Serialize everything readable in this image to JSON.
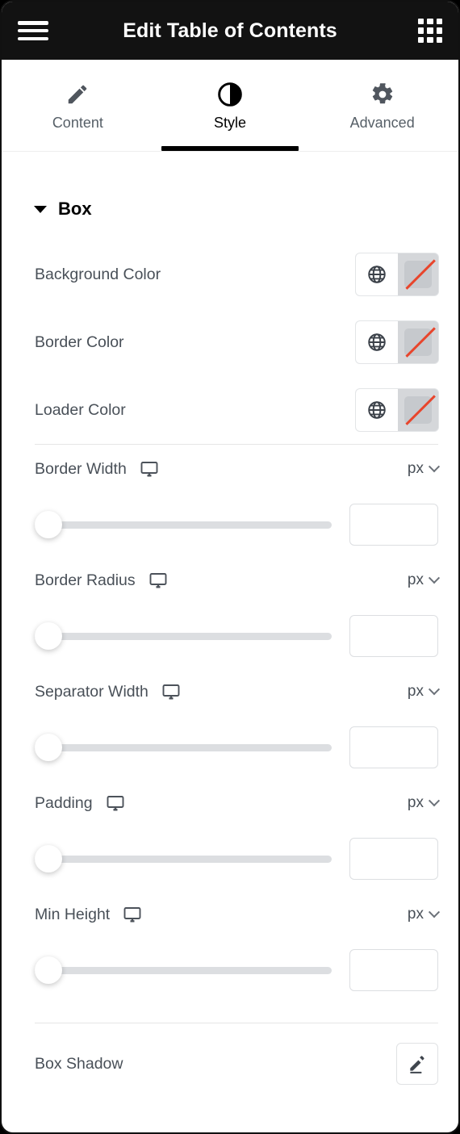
{
  "header": {
    "title": "Edit Table of Contents",
    "menu_icon": "hamburger-menu-icon",
    "apps_icon": "apps-grid-icon"
  },
  "tabs": [
    {
      "label": "Content",
      "icon": "pencil-icon",
      "active": false
    },
    {
      "label": "Style",
      "icon": "half-circle-contrast-icon",
      "active": true
    },
    {
      "label": "Advanced",
      "icon": "gear-icon",
      "active": false
    }
  ],
  "section": {
    "title": "Box",
    "collapse_icon": "caret-down-icon",
    "expanded": true
  },
  "color_controls": [
    {
      "label": "Background Color",
      "globe_icon": "globe-icon",
      "swatch_icon": "no-color-swatch-icon",
      "value": ""
    },
    {
      "label": "Border Color",
      "globe_icon": "globe-icon",
      "swatch_icon": "no-color-swatch-icon",
      "value": ""
    },
    {
      "label": "Loader Color",
      "globe_icon": "globe-icon",
      "swatch_icon": "no-color-swatch-icon",
      "value": ""
    }
  ],
  "slider_controls": [
    {
      "label": "Border Width",
      "device_icon": "desktop-monitor-icon",
      "unit": "px",
      "unit_chevron": "chevron-down-icon",
      "value": "",
      "slider_position_percent": 0
    },
    {
      "label": "Border Radius",
      "device_icon": "desktop-monitor-icon",
      "unit": "px",
      "unit_chevron": "chevron-down-icon",
      "value": "",
      "slider_position_percent": 0
    },
    {
      "label": "Separator Width",
      "device_icon": "desktop-monitor-icon",
      "unit": "px",
      "unit_chevron": "chevron-down-icon",
      "value": "",
      "slider_position_percent": 0
    },
    {
      "label": "Padding",
      "device_icon": "desktop-monitor-icon",
      "unit": "px",
      "unit_chevron": "chevron-down-icon",
      "value": "",
      "slider_position_percent": 0
    },
    {
      "label": "Min Height",
      "device_icon": "desktop-monitor-icon",
      "unit": "px",
      "unit_chevron": "chevron-down-icon",
      "value": "",
      "slider_position_percent": 0
    }
  ],
  "box_shadow": {
    "label": "Box Shadow",
    "edit_icon": "pencil-edit-icon"
  },
  "colors": {
    "header_bg": "#121212",
    "accent_active": "#000000",
    "label_text": "#495058",
    "track": "#dcdee1",
    "swatch_slash": "#e8452c",
    "divider": "#e6e6e6"
  }
}
